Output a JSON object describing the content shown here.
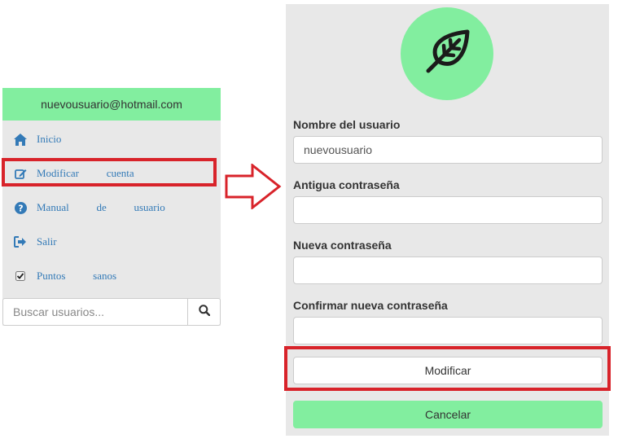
{
  "sidebar": {
    "user_email": "nuevousuario@hotmail.com",
    "items": [
      {
        "label": "Inicio",
        "icon": "home-icon"
      },
      {
        "label": "Modificar   cuenta",
        "icon": "edit-icon"
      },
      {
        "label": "Manual   de   usuario",
        "icon": "question-circle-icon"
      },
      {
        "label": "Salir",
        "icon": "sign-out-icon"
      },
      {
        "label": "Puntos   sanos",
        "icon": "checkbox-icon"
      }
    ],
    "search": {
      "placeholder": "Buscar usuarios...",
      "icon": "search-icon"
    }
  },
  "form": {
    "avatar_icon": "leaf-icon",
    "fields": {
      "username": {
        "label": "Nombre del usuario",
        "value": "nuevousuario"
      },
      "old_password": {
        "label": "Antigua contraseña",
        "value": ""
      },
      "new_password": {
        "label": "Nueva contraseña",
        "value": ""
      },
      "confirm_password": {
        "label": "Confirmar nueva contraseña",
        "value": ""
      }
    },
    "submit_label": "Modificar",
    "cancel_label": "Cancelar"
  },
  "colors": {
    "accent_green": "#82ee9f",
    "panel_gray": "#e8e8e8",
    "link_blue": "#337ab7",
    "highlight_red": "#d8232a"
  }
}
